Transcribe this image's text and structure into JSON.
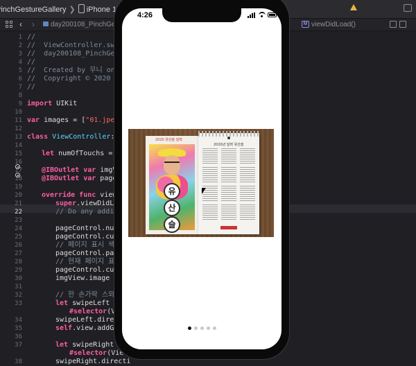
{
  "toolbar": {
    "scheme_target": "PinchGestureGallery",
    "scheme_separator": "❯",
    "device": "iPhone 11 Pro Max"
  },
  "jumpbar": {
    "back_icon": "chevron-left-icon",
    "forward_icon": "chevron-right-icon",
    "path_folder": "day200108_PinchGesture",
    "method_badge": "M",
    "method": "viewDidLoad()"
  },
  "editor": {
    "gutter": [
      {
        "n": "1"
      },
      {
        "n": "2"
      },
      {
        "n": "3"
      },
      {
        "n": "4"
      },
      {
        "n": "5"
      },
      {
        "n": "6"
      },
      {
        "n": "7"
      },
      {
        "n": "8"
      },
      {
        "n": "9"
      },
      {
        "n": "10"
      },
      {
        "n": "11"
      },
      {
        "n": "12"
      },
      {
        "n": "13"
      },
      {
        "n": "14"
      },
      {
        "n": "15"
      },
      {
        "n": "16"
      },
      {
        "n": "17"
      },
      {
        "n": "18"
      },
      {
        "n": "19"
      },
      {
        "n": "20"
      },
      {
        "n": "21"
      },
      {
        "n": "22"
      },
      {
        "n": "23"
      },
      {
        "n": "24"
      },
      {
        "n": "25"
      },
      {
        "n": "26"
      },
      {
        "n": "27"
      },
      {
        "n": "28"
      },
      {
        "n": "29"
      },
      {
        "n": "30"
      },
      {
        "n": "31"
      },
      {
        "n": "32"
      },
      {
        "n": "33"
      },
      {
        "n": "",
        "blank": true
      },
      {
        "n": "34"
      },
      {
        "n": "35"
      },
      {
        "n": "36"
      },
      {
        "n": "37"
      },
      {
        "n": "",
        "blank": true
      },
      {
        "n": "38"
      }
    ],
    "current_line": "22",
    "lines": {
      "l1": "//",
      "l2": "//  ViewController.swift",
      "l3": "//  day200108_PinchGestu",
      "l4": "//",
      "l5": "//  Created by 무니 on 20",
      "l6": "//  Copyright © 2020 com",
      "l7": "//",
      "l9_kw": "import",
      "l9_rest": " UIKit",
      "l11_kw": "var",
      "l11_rest": " images = [",
      "l11_str": "\"01.jpeg\"",
      "l11_tail": ",",
      "l13_kw": "class",
      "l13_name": " ViewController",
      "l13_rest": ": UI",
      "l15_kw": "let",
      "l15_rest": " numOfTouchs = ",
      "l15_num": "2",
      "l17_at": "@IBOutlet",
      "l17_kw": " var",
      "l17_rest": " imgVie",
      "l18_at": "@IBOutlet",
      "l18_kw": " var",
      "l18_rest": " pageCo",
      "l20_kw": "override func",
      "l20_rest": " viewDid",
      "l21_kw": "super",
      "l21_rest": ".viewDidLoa",
      "l22": "// Do any additi",
      "l24": "pageControl.numbe",
      "l25": "pageControl.curre",
      "l26": "// 페이지 표시 색상",
      "l27": "pageControl.page",
      "l28": "// 현재 페이지 표시",
      "l29": "pageControl.curre",
      "l30": "imgView.image = (",
      "l32": "// 한 손가락 스와이프",
      "l33_kw": "let",
      "l33_rest": " swipeLeft = ",
      "l33b_kw": "#selector",
      "l33b_rest": "(Vie",
      "l34": "swipeLeft.direct",
      "l35_kw": "self",
      "l35_rest": ".view.addGest",
      "l37_kw": "let",
      "l37_rest": " swipeRight = ",
      "l37b_kw": "#selector",
      "l37b_rest": "(Vie",
      "l38": "swipeRight.directi"
    }
  },
  "simulator": {
    "time": "4:26",
    "photo_card_title": "2020 유산슬 달력",
    "photo_letters": [
      "유",
      "산",
      "슬"
    ],
    "calendar_title": "2020년 달력 유산슬",
    "page_count": 5,
    "current_page": 0
  },
  "colors": {
    "editor_bg": "#1f1f24",
    "keyword": "#fc5fa3",
    "comment": "#7f8c98",
    "string": "#fc6a5d",
    "type": "#5dd8ff",
    "warning": "#e7b63f"
  }
}
